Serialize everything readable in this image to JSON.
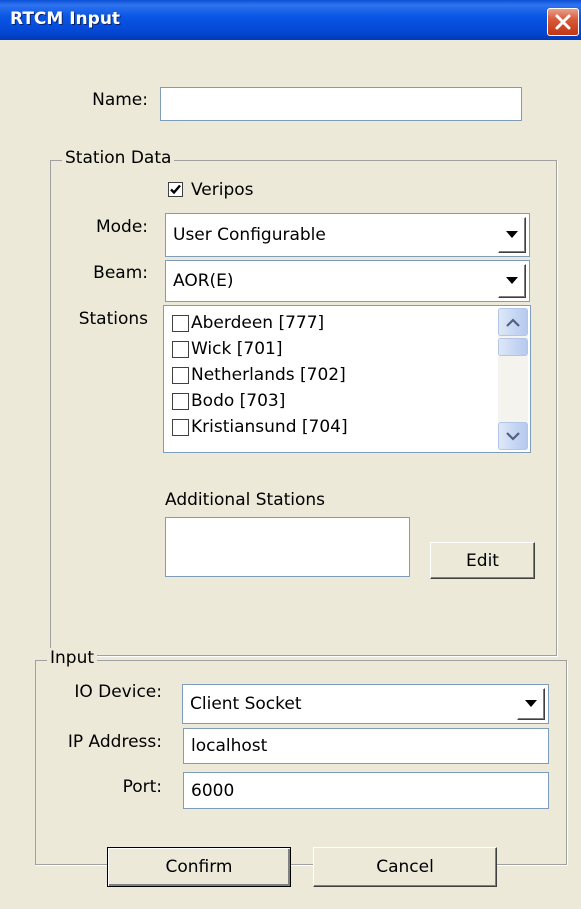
{
  "window": {
    "title": "RTCM Input"
  },
  "name_field": {
    "label": "Name:",
    "value": ""
  },
  "station_data": {
    "legend": "Station Data",
    "veripos": {
      "label": "Veripos",
      "checked": true
    },
    "mode": {
      "label": "Mode:",
      "value": "User Configurable"
    },
    "beam": {
      "label": "Beam:",
      "value": "AOR(E)"
    },
    "stations": {
      "label": "Stations",
      "items": [
        {
          "label": "Aberdeen [777]",
          "checked": false
        },
        {
          "label": "Wick [701]",
          "checked": false
        },
        {
          "label": "Netherlands [702]",
          "checked": false
        },
        {
          "label": "Bodo [703]",
          "checked": false
        },
        {
          "label": "Kristiansund [704]",
          "checked": false
        }
      ]
    },
    "additional_stations": {
      "label": "Additional Stations",
      "value": "",
      "edit_label": "Edit"
    }
  },
  "input": {
    "legend": "Input",
    "io_device": {
      "label": "IO Device:",
      "value": "Client Socket"
    },
    "ip_address": {
      "label": "IP Address:",
      "value": "localhost"
    },
    "port": {
      "label": "Port:",
      "value": "6000"
    }
  },
  "buttons": {
    "confirm": "Confirm",
    "cancel": "Cancel"
  }
}
